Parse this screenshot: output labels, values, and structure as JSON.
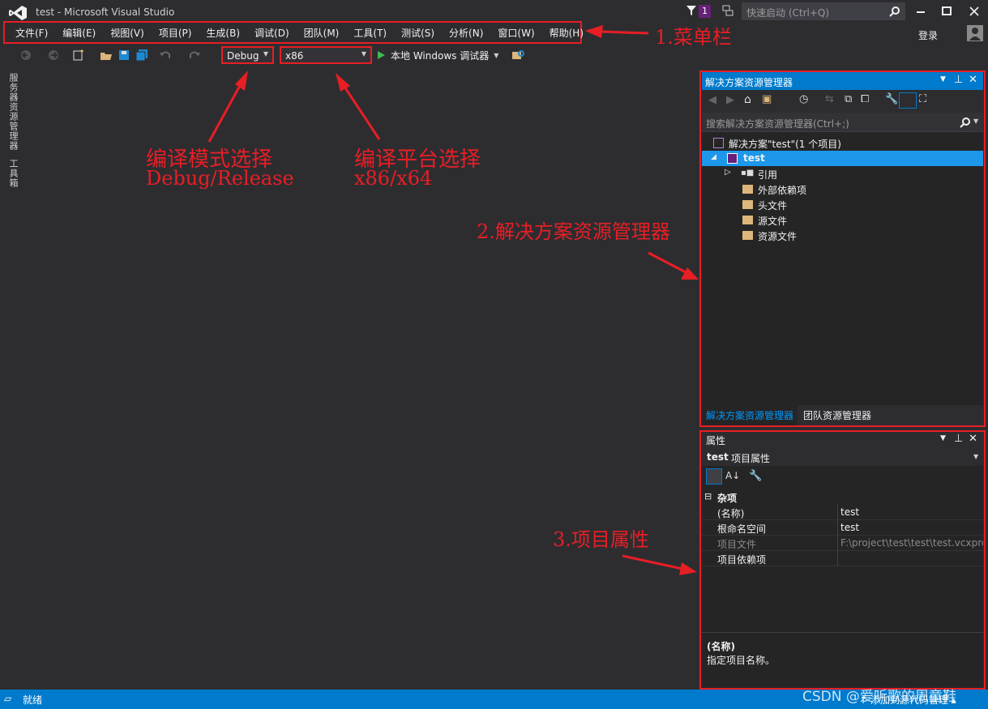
{
  "window": {
    "title": "test - Microsoft Visual Studio",
    "notification_count": "1",
    "quick_launch_placeholder": "快速启动 (Ctrl+Q)",
    "login_label": "登录"
  },
  "menu": {
    "items": [
      "文件(F)",
      "编辑(E)",
      "视图(V)",
      "项目(P)",
      "生成(B)",
      "调试(D)",
      "团队(M)",
      "工具(T)",
      "测试(S)",
      "分析(N)",
      "窗口(W)",
      "帮助(H)"
    ]
  },
  "toolbar": {
    "config_value": "Debug",
    "platform_value": "x86",
    "run_label": "本地 Windows 调试器"
  },
  "side_tabs": [
    "服务器资源管理器",
    "工具箱"
  ],
  "annotations": {
    "menu_bar": "1.菜单栏",
    "mode_title": "编译模式选择",
    "mode_sub": "Debug/Release",
    "platform_title": "编译平台选择",
    "platform_sub": "x86/x64",
    "solution_explorer": "2.解决方案资源管理器",
    "project_props": "3.项目属性"
  },
  "solution_explorer": {
    "title": "解决方案资源管理器",
    "search_placeholder": "搜索解决方案资源管理器(Ctrl+;)",
    "tree": [
      {
        "label": "解决方案\"test\"(1 个项目)",
        "level": 0
      },
      {
        "label": "test",
        "level": 1,
        "selected": true
      },
      {
        "label": "引用",
        "level": 2
      },
      {
        "label": "外部依赖项",
        "level": 2
      },
      {
        "label": "头文件",
        "level": 2
      },
      {
        "label": "源文件",
        "level": 2
      },
      {
        "label": "资源文件",
        "level": 2
      }
    ],
    "tabs": [
      "解决方案资源管理器",
      "团队资源管理器"
    ]
  },
  "properties": {
    "title": "属性",
    "object_name": "test",
    "object_type": "项目属性",
    "category": "杂项",
    "rows": [
      {
        "key": "(名称)",
        "value": "test"
      },
      {
        "key": "根命名空间",
        "value": "test"
      },
      {
        "key": "项目文件",
        "value": "F:\\project\\test\\test\\test.vcxproj"
      },
      {
        "key": "项目依赖项",
        "value": ""
      }
    ],
    "desc_title": "(名称)",
    "desc_text": "指定项目名称。"
  },
  "status": {
    "ready": "就绪",
    "source_control": "↑ 添加到源代码管理 ▴"
  },
  "watermark": "CSDN @爱听歌的周童鞋",
  "colors": {
    "accent": "#007acc",
    "highlight": "#e81e25",
    "background": "#2d2d30"
  }
}
